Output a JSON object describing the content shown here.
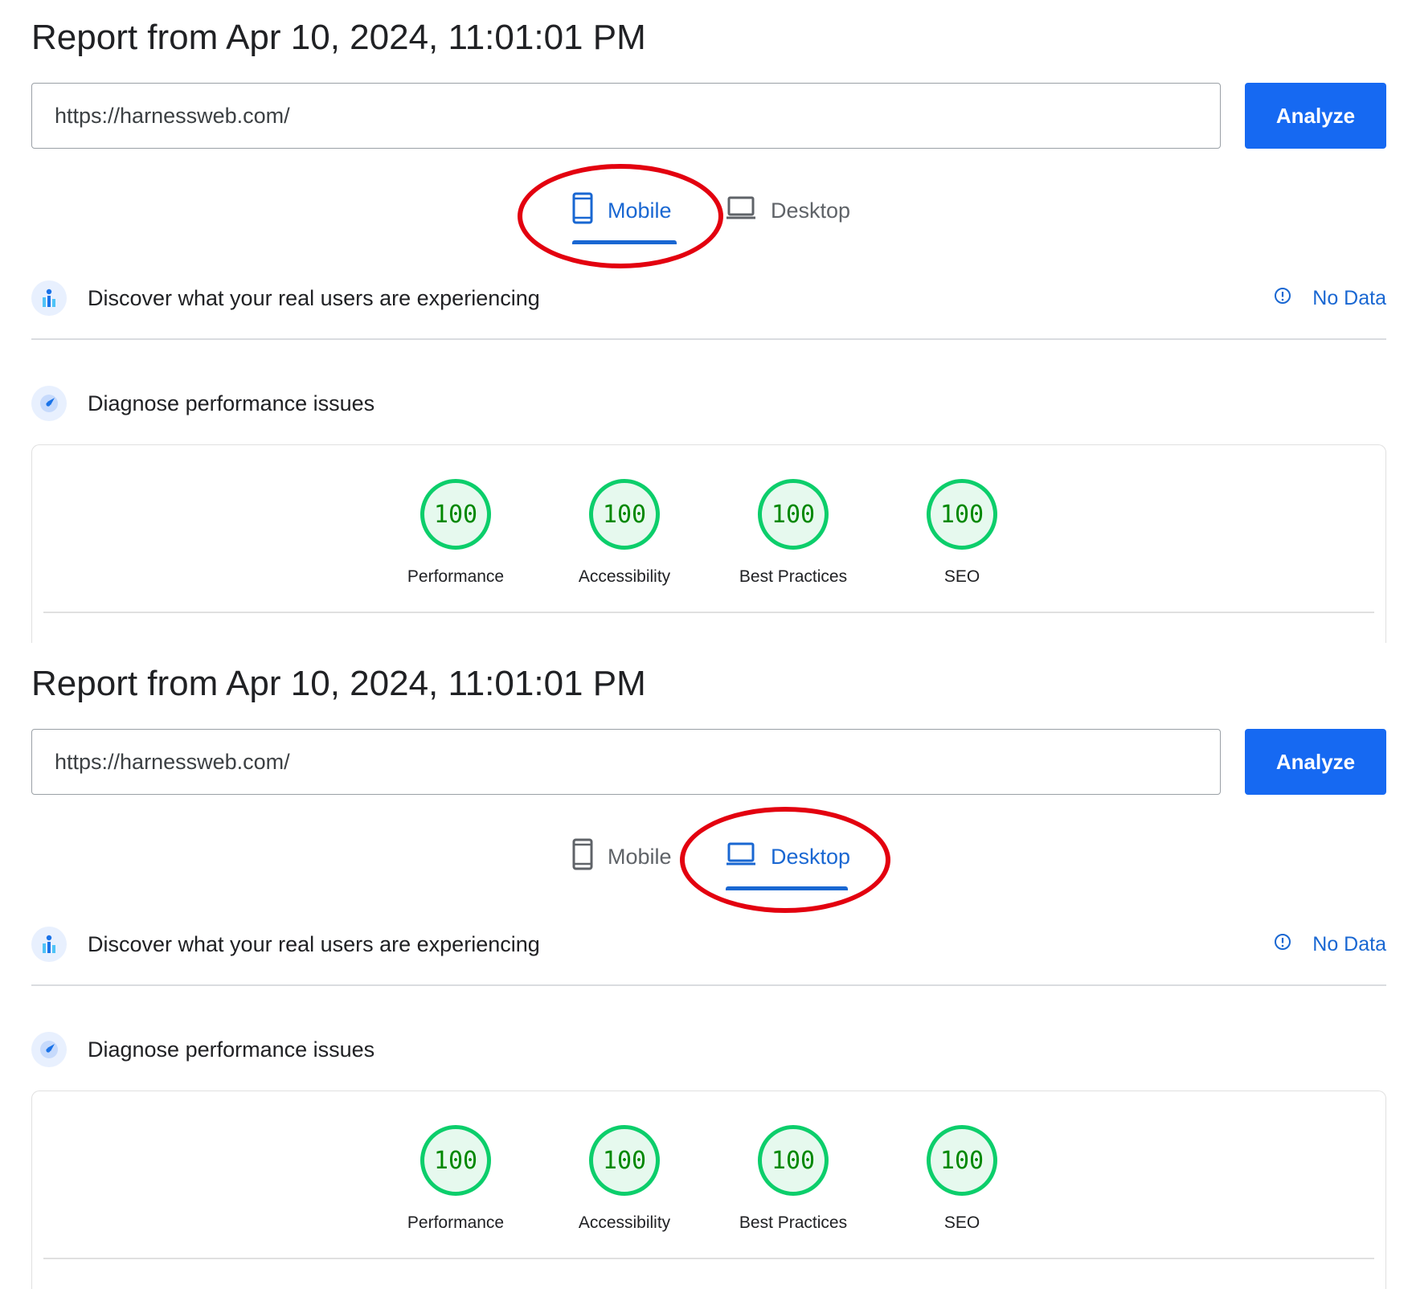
{
  "panels": [
    {
      "report_title": "Report from Apr 10, 2024, 11:01:01 PM",
      "url_value": "https://harnessweb.com/",
      "analyze_label": "Analyze",
      "tabs": {
        "mobile": "Mobile",
        "desktop": "Desktop",
        "active": "mobile"
      },
      "field_data": {
        "title": "Discover what your real users are experiencing",
        "status": "No Data"
      },
      "lab_data": {
        "title": "Diagnose performance issues"
      },
      "scores": [
        {
          "label": "Performance",
          "value": "100"
        },
        {
          "label": "Accessibility",
          "value": "100"
        },
        {
          "label": "Best Practices",
          "value": "100"
        },
        {
          "label": "SEO",
          "value": "100"
        }
      ]
    },
    {
      "report_title": "Report from Apr 10, 2024, 11:01:01 PM",
      "url_value": "https://harnessweb.com/",
      "analyze_label": "Analyze",
      "tabs": {
        "mobile": "Mobile",
        "desktop": "Desktop",
        "active": "desktop"
      },
      "field_data": {
        "title": "Discover what your real users are experiencing",
        "status": "No Data"
      },
      "lab_data": {
        "title": "Diagnose performance issues"
      },
      "scores": [
        {
          "label": "Performance",
          "value": "100"
        },
        {
          "label": "Accessibility",
          "value": "100"
        },
        {
          "label": "Best Practices",
          "value": "100"
        },
        {
          "label": "SEO",
          "value": "100"
        }
      ]
    }
  ],
  "colors": {
    "accent_blue": "#1967d2",
    "button_blue": "#1669f2",
    "score_green": "#0cce6b",
    "score_text": "#008800",
    "annotation_red": "#e3000f"
  },
  "icons": {
    "mobile": "phone-icon",
    "desktop": "laptop-icon",
    "field_data": "users-chart-icon",
    "lab_data": "compass-icon",
    "info": "info-icon"
  }
}
